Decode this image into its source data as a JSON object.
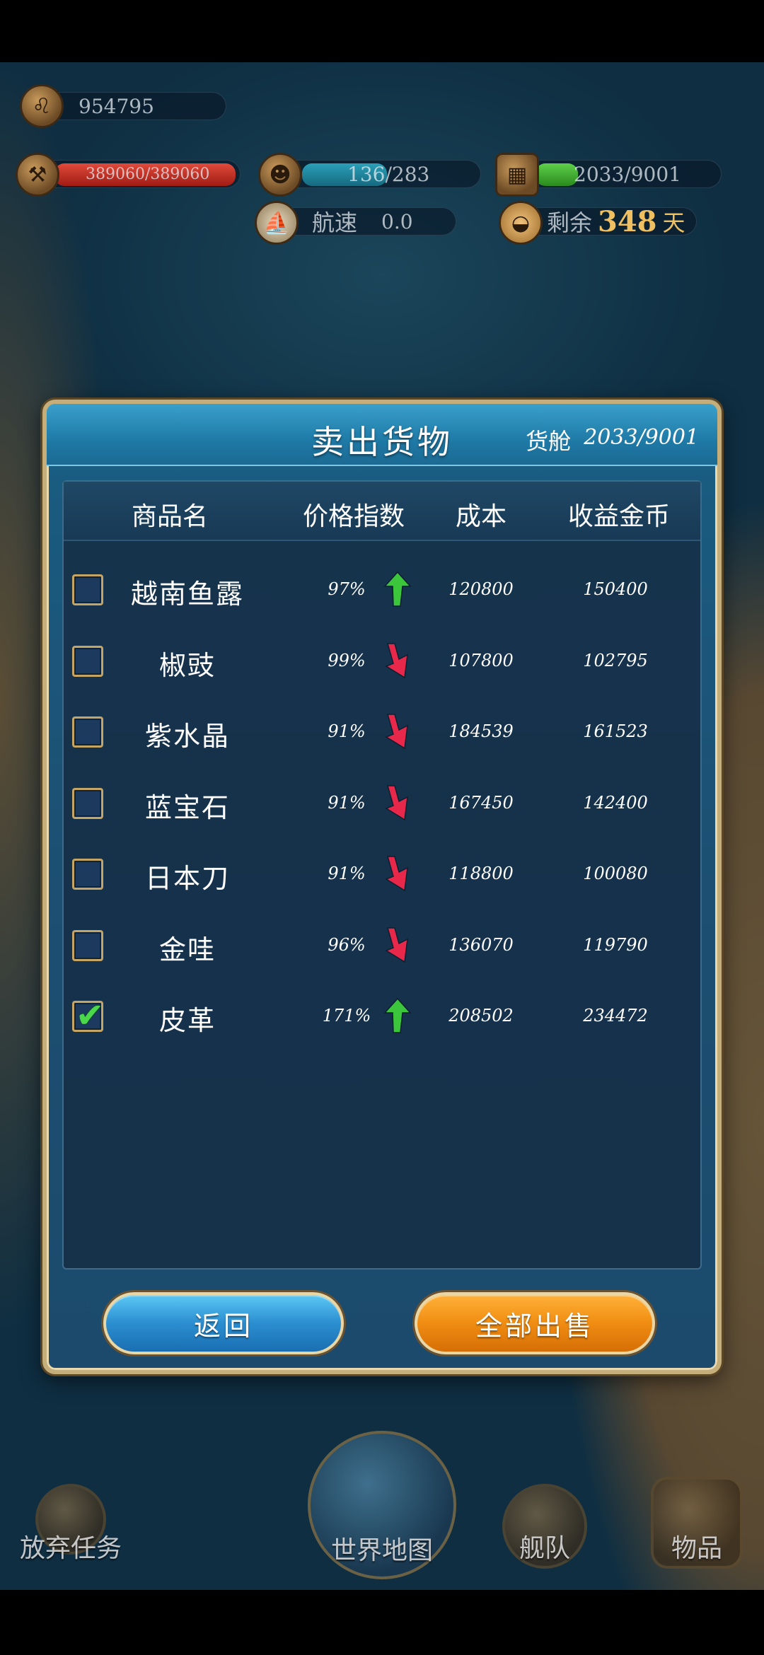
{
  "hud": {
    "gold": "954795",
    "durability": "389060/389060",
    "crew": "136/283",
    "cargo": "2033/9001",
    "speed_label": "航速",
    "speed_value": "0.0",
    "remaining_label": "剩余",
    "remaining_days": "348",
    "days_unit": "天"
  },
  "dialog": {
    "title": "卖出货物",
    "cargo_label": "货舱",
    "cargo_value": "2033/9001",
    "headers": {
      "name": "商品名",
      "price_index": "价格指数",
      "cost": "成本",
      "revenue": "收益金币"
    },
    "rows": [
      {
        "name": "越南鱼露",
        "index": "97%",
        "trend": "up",
        "cost": "120800",
        "revenue": "150400",
        "checked": false
      },
      {
        "name": "椒豉",
        "index": "99%",
        "trend": "down",
        "cost": "107800",
        "revenue": "102795",
        "checked": false
      },
      {
        "name": "紫水晶",
        "index": "91%",
        "trend": "down",
        "cost": "184539",
        "revenue": "161523",
        "checked": false
      },
      {
        "name": "蓝宝石",
        "index": "91%",
        "trend": "down",
        "cost": "167450",
        "revenue": "142400",
        "checked": false
      },
      {
        "name": "日本刀",
        "index": "91%",
        "trend": "down",
        "cost": "118800",
        "revenue": "100080",
        "checked": false
      },
      {
        "name": "金哇",
        "index": "96%",
        "trend": "down",
        "cost": "136070",
        "revenue": "119790",
        "checked": false
      },
      {
        "name": "皮革",
        "index": "171%",
        "trend": "up",
        "cost": "208502",
        "revenue": "234472",
        "checked": true
      }
    ],
    "back_button": "返回",
    "sell_all_button": "全部出售"
  },
  "nav": {
    "abandon": "放弃任务",
    "world_map": "世界地图",
    "fleet": "舰队",
    "items": "物品"
  },
  "colors": {
    "trend_up": "#3cc63c",
    "trend_down": "#e8284a",
    "checkbox_border": "#c5a566",
    "back_button": "#2b8ed0",
    "sell_all_button": "#f08d12"
  }
}
